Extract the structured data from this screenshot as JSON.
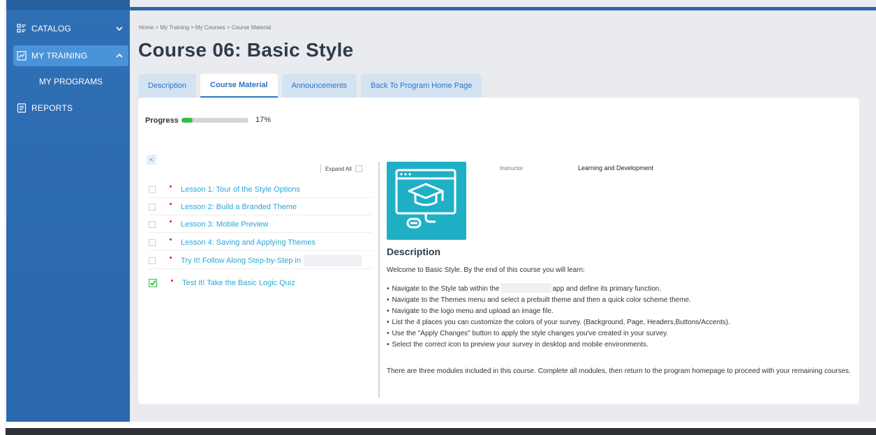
{
  "sidebar": {
    "catalog": "CATALOG",
    "my_training": "MY TRAINING",
    "my_programs": "MY PROGRAMS",
    "reports": "REPORTS"
  },
  "breadcrumb": "Home > My Training > My Courses > Course Material",
  "page_title": "Course 06: Basic Style",
  "tabs": [
    "Description",
    "Course Material",
    "Announcements",
    "Back To Program Home Page"
  ],
  "progress": {
    "label": "Progress",
    "value": 0.17,
    "text": "17%"
  },
  "collapse_label": "<",
  "expand_all": "Expand All",
  "lessons": [
    "Lesson 1: Tour of the Style Options",
    "Lesson 2: Build a Branded Theme",
    "Lesson 3: Mobile Preview",
    "Lesson 4: Saving and Applying Themes",
    "Try It! Follow Along Step-by-Step in",
    "Test It! Take the Basic Logic Quiz"
  ],
  "instructor": {
    "label": "Instructor",
    "value": "Learning and Development"
  },
  "description": {
    "title": "Description",
    "intro": "Welcome to Basic Style. By the end of this course you will learn:",
    "bullet1_a": "Navigate to the Style tab within the",
    "bullet1_b": "app and define its primary function.",
    "bullet2": "Navigate to the Themes menu and select a prebuilt theme and then a quick color scheme theme.",
    "bullet3": "Navigate to the logo menu and upload an image file.",
    "bullet4": "List the 4 places you can customize the colors of your survey. (Background, Page, Headers,Buttons/Accents).",
    "bullet5": "Use the \"Apply Changes\" button to apply the style changes you've created in your survey.",
    "bullet6": "Select the correct icon to preview your survey in desktop and mobile environments.",
    "outro": "There are three modules included in this course. Complete all modules, then return to the program homepage to proceed with your remaining courses."
  },
  "colors": {
    "sidebar": "#2f6fb5",
    "active_nav": "#4a93d8",
    "link": "#2aa7d6",
    "progress": "#2fbf46",
    "thumbnail": "#1fb0c6"
  }
}
